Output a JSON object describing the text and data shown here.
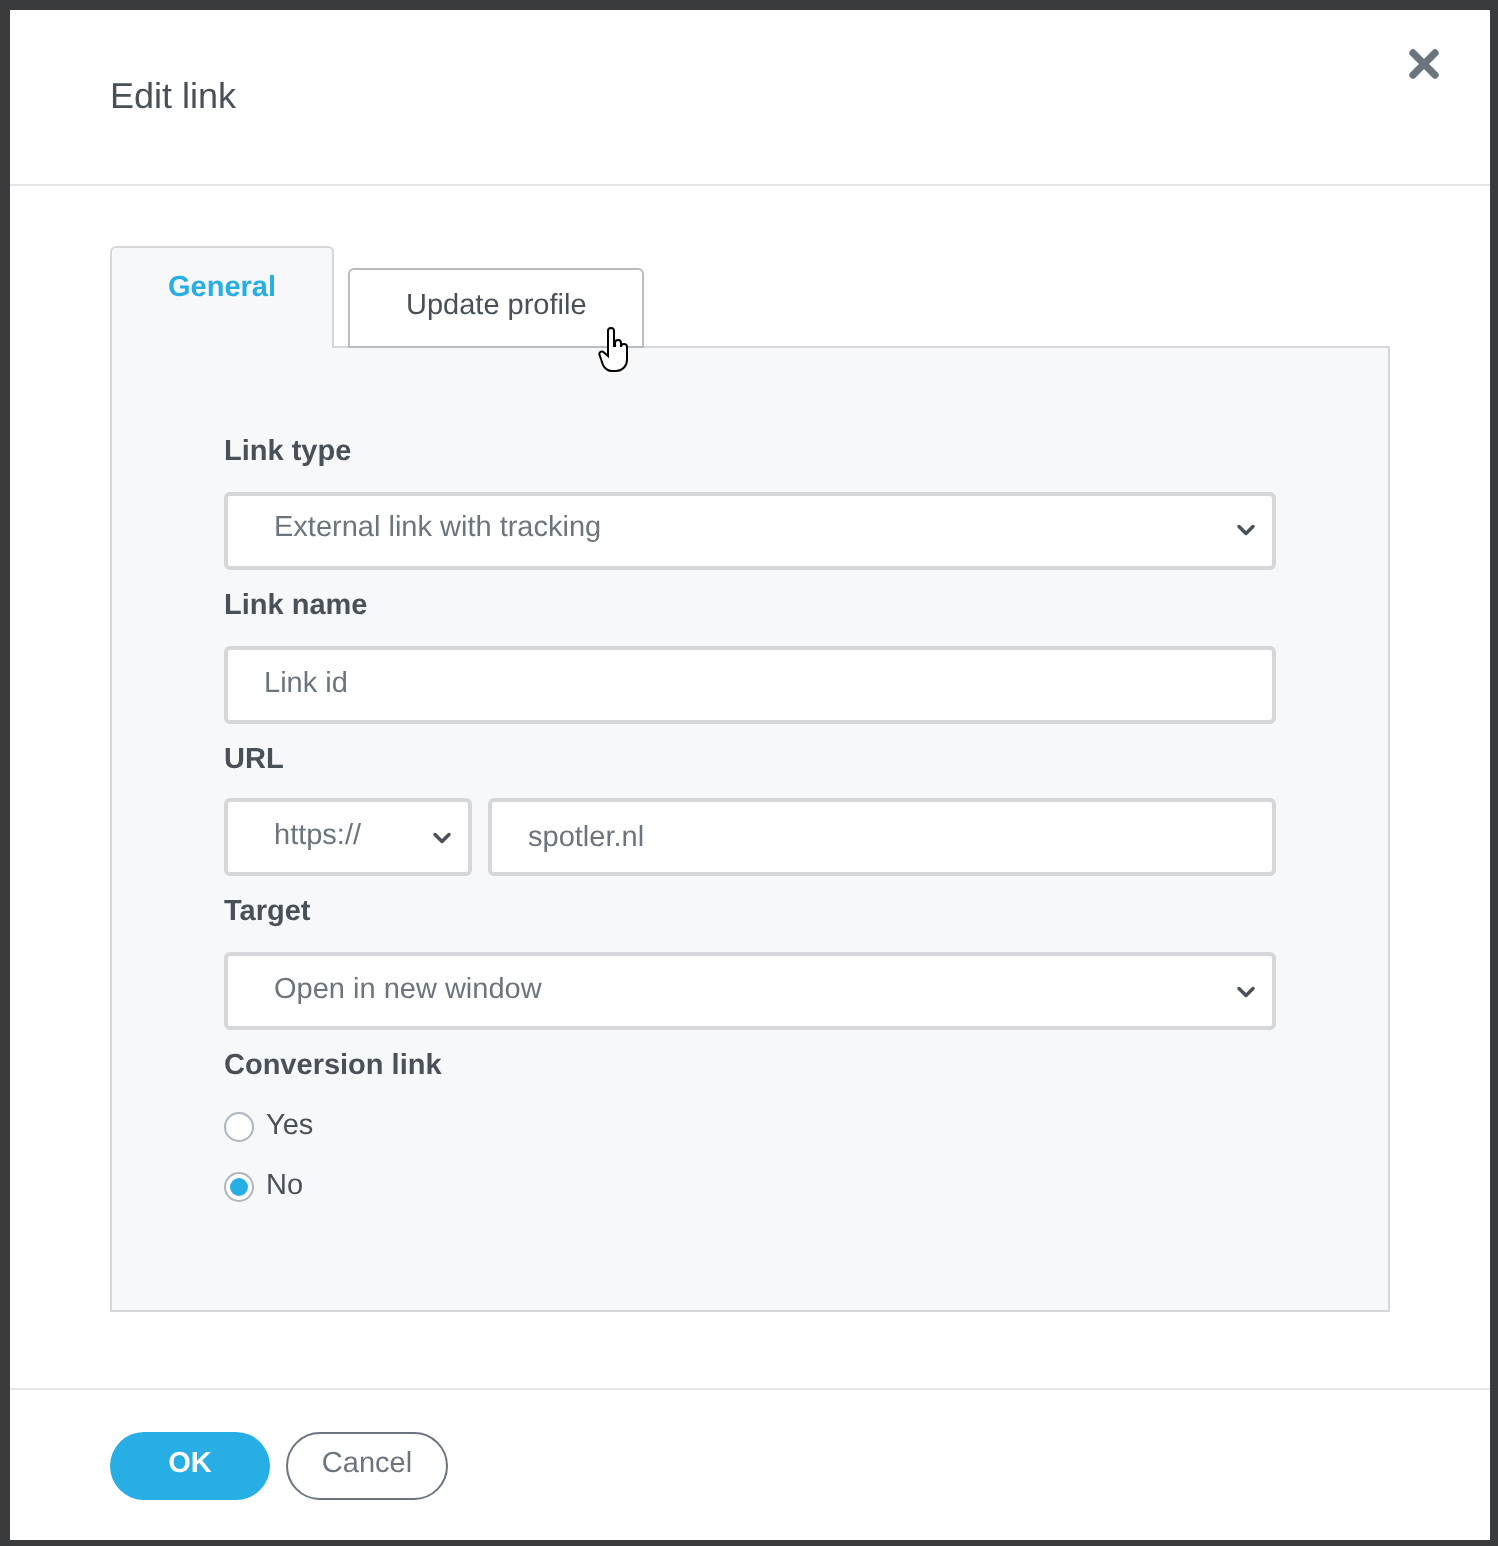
{
  "dialog": {
    "title": "Edit link",
    "tabs": [
      {
        "label": "General",
        "selected": true
      },
      {
        "label": "Update profile",
        "selected": false
      }
    ],
    "fields": [
      {
        "kind": "select",
        "label": "Link type",
        "value": "External link with tracking"
      },
      {
        "kind": "input",
        "label": "Link name",
        "placeholder": "Link id"
      },
      {
        "kind": "url",
        "label": "URL",
        "protocol": "https://",
        "value": "spotler.nl"
      },
      {
        "kind": "select",
        "label": "Target",
        "value": "Open in new window"
      },
      {
        "kind": "radio",
        "label": "Conversion link",
        "options": [
          {
            "label": "Yes",
            "selected": false
          },
          {
            "label": "No",
            "selected": true
          }
        ]
      }
    ],
    "buttons": [
      {
        "label": "OK",
        "kind": "primary"
      },
      {
        "label": "Cancel",
        "kind": "secondary"
      }
    ]
  }
}
